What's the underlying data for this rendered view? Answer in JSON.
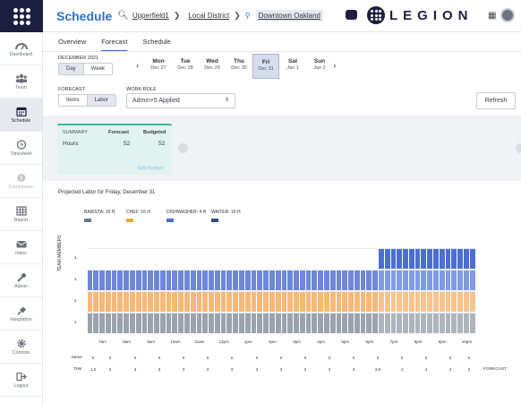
{
  "colors": {
    "brand_navy": "#1d1f3f",
    "accent_blue": "#2f6fc4",
    "barista": "#5b7ec9",
    "chef": "#f0a63f",
    "dishwasher": "#5f82d8",
    "waiter": "#2d4f86"
  },
  "sidebar": {
    "items": [
      {
        "label": "Dashboard",
        "icon": "dashboard-icon"
      },
      {
        "label": "Team",
        "icon": "team-icon"
      },
      {
        "label": "Schedule",
        "icon": "calendar-icon"
      },
      {
        "label": "Timesheet",
        "icon": "clock-icon"
      },
      {
        "label": "Compliance",
        "icon": "alert-icon"
      },
      {
        "label": "Report",
        "icon": "report-icon"
      },
      {
        "label": "Inbox",
        "icon": "inbox-icon"
      },
      {
        "label": "Admin",
        "icon": "wrench-icon"
      },
      {
        "label": "Integration",
        "icon": "plug-icon"
      },
      {
        "label": "Controls",
        "icon": "gear-icon"
      },
      {
        "label": "Logout",
        "icon": "logout-icon"
      }
    ]
  },
  "header": {
    "title": "Schedule",
    "crumbs": [
      "Upperfield1",
      "Local District",
      "Downtown Oakland"
    ],
    "brand": "LEGION"
  },
  "tabs": [
    "Overview",
    "Forecast",
    "Schedule"
  ],
  "date": {
    "month": "DECEMBER 2021",
    "view": [
      "Day",
      "Week"
    ],
    "days": [
      {
        "name": "Mon",
        "date": "Dec 27"
      },
      {
        "name": "Tue",
        "date": "Dec 28"
      },
      {
        "name": "Wed",
        "date": "Dec 29"
      },
      {
        "name": "Thu",
        "date": "Dec 30"
      },
      {
        "name": "Fri",
        "date": "Dec 31"
      },
      {
        "name": "Sat",
        "date": "Jan 1"
      },
      {
        "name": "Sun",
        "date": "Jan 2"
      }
    ]
  },
  "forecast": {
    "label": "FORECAST",
    "toggle": [
      "Items",
      "Labor"
    ],
    "work_role_label": "WORK ROLE",
    "work_role_value": "Admin+5 Applied",
    "refresh": "Refresh"
  },
  "summary": {
    "title": "SUMMARY",
    "col1": "Forecast",
    "col2": "Budgeted",
    "row_label": "Hours",
    "forecast": "52",
    "budgeted": "52",
    "edit": "Edit Budget"
  },
  "chart_data": {
    "type": "bar",
    "title": "Projected Labor for Friday, December 31",
    "ylabel": "TEAM MEMBERS",
    "ylim": [
      0,
      4
    ],
    "legend": [
      {
        "name": "BARISTA",
        "value": "16 H"
      },
      {
        "name": "CHEF",
        "value": "16 H"
      },
      {
        "name": "DISHWASHER",
        "value": "4 H"
      },
      {
        "name": "WAITER",
        "value": "16 H"
      }
    ],
    "yticks": [
      "1",
      "2",
      "3",
      "4"
    ],
    "xticks": [
      "7am",
      "8am",
      "9am",
      "10am",
      "11am",
      "12pm",
      "1pm",
      "2pm",
      "3pm",
      "4pm",
      "5pm",
      "6pm",
      "7pm",
      "8pm",
      "9pm",
      "10pm"
    ],
    "series": [
      {
        "name": "BARISTA",
        "values": [
          1,
          1,
          1,
          1,
          1,
          1,
          1,
          1,
          1,
          1,
          1,
          1,
          1,
          1,
          1,
          1,
          1,
          1,
          1,
          1,
          1,
          1,
          1,
          1,
          1,
          1,
          1,
          1,
          1,
          1,
          1,
          1,
          1,
          1,
          1,
          1,
          1,
          1,
          1,
          1,
          1,
          1,
          1,
          1,
          1,
          1,
          1,
          1,
          1,
          1,
          1,
          1,
          1,
          1,
          1,
          1,
          1,
          1,
          1,
          1,
          1,
          1,
          1,
          1
        ]
      },
      {
        "name": "CHEF",
        "values": [
          1,
          1,
          1,
          1,
          1,
          1,
          1,
          1,
          1,
          1,
          1,
          1,
          1,
          1,
          1,
          1,
          1,
          1,
          1,
          1,
          1,
          1,
          1,
          1,
          1,
          1,
          1,
          1,
          1,
          1,
          1,
          1,
          1,
          1,
          1,
          1,
          1,
          1,
          1,
          1,
          1,
          1,
          1,
          1,
          1,
          1,
          1,
          1,
          1,
          1,
          1,
          1,
          1,
          1,
          1,
          1,
          1,
          1,
          1,
          1,
          1,
          1,
          1,
          1
        ]
      },
      {
        "name": "WAITER",
        "values": [
          1,
          1,
          1,
          1,
          1,
          1,
          1,
          1,
          1,
          1,
          1,
          1,
          1,
          1,
          1,
          1,
          1,
          1,
          1,
          1,
          1,
          1,
          1,
          1,
          1,
          1,
          1,
          1,
          1,
          1,
          1,
          1,
          1,
          1,
          1,
          1,
          1,
          1,
          1,
          1,
          1,
          1,
          1,
          1,
          1,
          1,
          1,
          1,
          1,
          1,
          1,
          1,
          1,
          1,
          1,
          1,
          1,
          1,
          1,
          1,
          1,
          1,
          1,
          1
        ]
      },
      {
        "name": "DISHWASHER",
        "values": [
          0,
          0,
          0,
          0,
          0,
          0,
          0,
          0,
          0,
          0,
          0,
          0,
          0,
          0,
          0,
          0,
          0,
          0,
          0,
          0,
          0,
          0,
          0,
          0,
          0,
          0,
          0,
          0,
          0,
          0,
          0,
          0,
          0,
          0,
          0,
          0,
          0,
          0,
          0,
          0,
          0,
          0,
          0,
          0,
          0,
          0,
          0,
          0,
          1,
          1,
          1,
          1,
          1,
          1,
          1,
          1,
          1,
          1,
          1,
          1,
          1,
          1,
          1,
          1
        ]
      }
    ],
    "row_items_label": "Items",
    "row_tms_label": "TMs",
    "items": [
      "0",
      "0",
      "0",
      "0",
      "0",
      "0",
      "0",
      "0",
      "0",
      "0",
      "0",
      "0",
      "0",
      "0",
      "0",
      "0",
      "0"
    ],
    "tms": [
      "1.5",
      "3",
      "3",
      "3",
      "3",
      "3",
      "3",
      "3",
      "3",
      "3",
      "3",
      "3",
      "3.5",
      "4",
      "4",
      "4",
      "2"
    ],
    "row_suffix": "FORECAST"
  }
}
